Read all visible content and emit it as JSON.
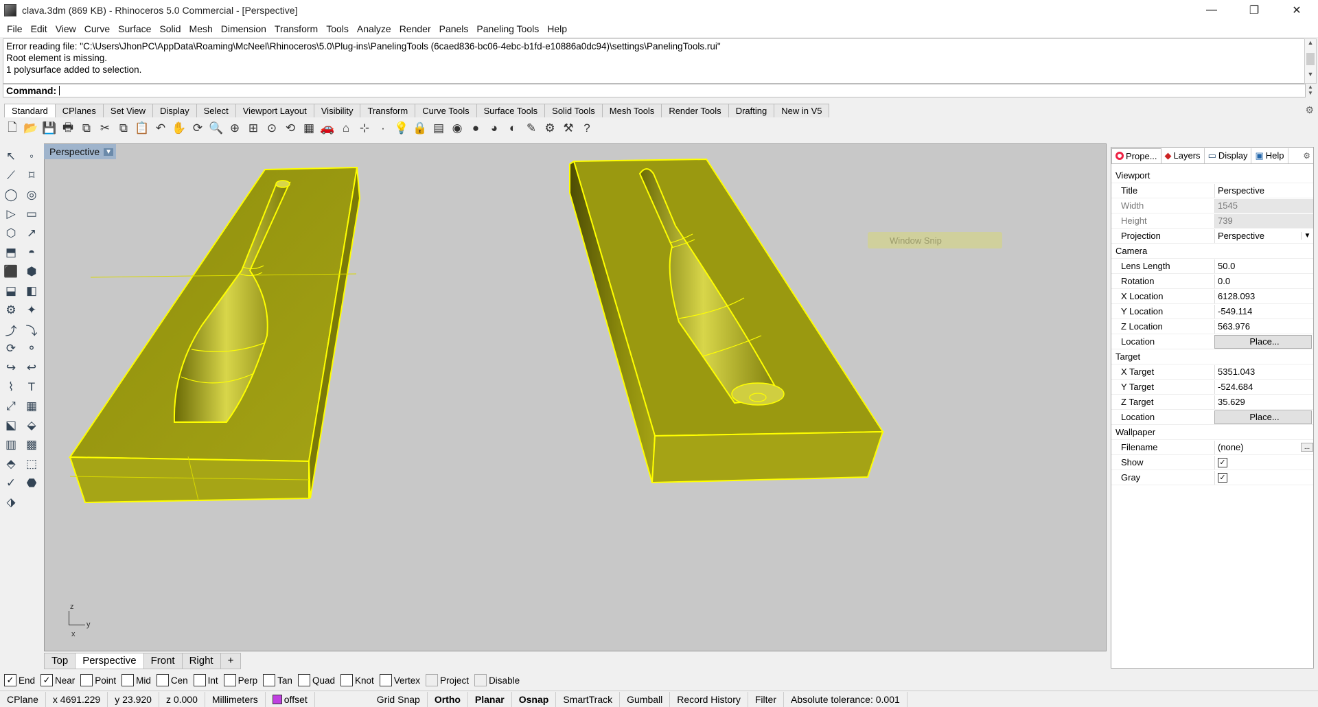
{
  "window": {
    "title": "clava.3dm (869 KB) - Rhinoceros 5.0 Commercial - [Perspective]",
    "minimize": "—",
    "maximize": "❐",
    "close": "✕"
  },
  "menu": [
    "File",
    "Edit",
    "View",
    "Curve",
    "Surface",
    "Solid",
    "Mesh",
    "Dimension",
    "Transform",
    "Tools",
    "Analyze",
    "Render",
    "Panels",
    "Paneling Tools",
    "Help"
  ],
  "history": [
    "Error reading file: \"C:\\Users\\JhonPC\\AppData\\Roaming\\McNeel\\Rhinoceros\\5.0\\Plug-ins\\PanelingTools (6caed836-bc06-4ebc-b1fd-e10886a0dc94)\\settings\\PanelingTools.rui\"",
    "Root element is missing.",
    "1 polysurface added to selection."
  ],
  "command": {
    "label": "Command:",
    "value": ""
  },
  "tabs": [
    "Standard",
    "CPlanes",
    "Set View",
    "Display",
    "Select",
    "Viewport Layout",
    "Visibility",
    "Transform",
    "Curve Tools",
    "Surface Tools",
    "Solid Tools",
    "Mesh Tools",
    "Render Tools",
    "Drafting",
    "New in V5"
  ],
  "toolbar_icons": [
    "new-icon",
    "open-icon",
    "save-icon",
    "print-icon",
    "import-icon",
    "cut-icon",
    "copy-icon",
    "paste-icon",
    "undo-icon",
    "pan-icon",
    "rotate-icon",
    "zoom-icon",
    "zoom-window-icon",
    "zoom-extents-icon",
    "zoom-selected-icon",
    "rotate-view-icon",
    "four-viewports-icon",
    "car-icon",
    "cplane-icon",
    "snap-icon",
    "point-icon",
    "light-icon",
    "lock-icon",
    "layer-icon",
    "color-wheel-icon",
    "render-sphere-icon",
    "material-sphere-icon",
    "render-icon",
    "paint-icon",
    "settings-icon",
    "options-icon",
    "help-icon"
  ],
  "toolbar_glyphs": [
    "🗋",
    "📂",
    "💾",
    "🖶",
    "⧉",
    "✂",
    "⧉",
    "📋",
    "↶",
    "✋",
    "⟳",
    "🔍",
    "⊕",
    "⊞",
    "⊙",
    "⟲",
    "▦",
    "🚗",
    "⌂",
    "⊹",
    "·",
    "💡",
    "🔒",
    "▤",
    "◉",
    "●",
    "◕",
    "◐",
    "✎",
    "⚙",
    "⚒",
    "?"
  ],
  "left_tools": [
    "↖",
    "◦",
    "⟋",
    "⌑",
    "◯",
    "◎",
    "▷",
    "▭",
    "⬡",
    "↗",
    "⬒",
    "◓",
    "⬛",
    "⬢",
    "⬓",
    "◧",
    "⚙",
    "✦",
    "⤴",
    "⤵",
    "⟳",
    "⚬",
    "↪",
    "↩",
    "⌇",
    "T",
    "⤢",
    "▦",
    "⬕",
    "⬙",
    "▥",
    "▩",
    "⬘",
    "⬚",
    "✓",
    "⬣",
    "⬗",
    ""
  ],
  "viewport": {
    "label": "Perspective",
    "snip_text": "Window Snip",
    "axis_z": "z",
    "axis_y": "y",
    "axis_x": "x",
    "object_color": "#9a9a10",
    "edge_color": "#ffff00",
    "background": "#c8c8c8"
  },
  "viewport_tabs": [
    "Top",
    "Perspective",
    "Front",
    "Right",
    "+"
  ],
  "props": {
    "tabs": [
      "Prope...",
      "Layers",
      "Display",
      "Help"
    ],
    "viewport_section": "Viewport",
    "title": {
      "k": "Title",
      "v": "Perspective"
    },
    "width": {
      "k": "Width",
      "v": "1545"
    },
    "height": {
      "k": "Height",
      "v": "739"
    },
    "projection": {
      "k": "Projection",
      "v": "Perspective"
    },
    "camera_section": "Camera",
    "lens": {
      "k": "Lens Length",
      "v": "50.0"
    },
    "rotation": {
      "k": "Rotation",
      "v": "0.0"
    },
    "xloc": {
      "k": "X Location",
      "v": "6128.093"
    },
    "yloc": {
      "k": "Y Location",
      "v": "-549.114"
    },
    "zloc": {
      "k": "Z Location",
      "v": "563.976"
    },
    "cam_location": {
      "k": "Location",
      "v": "Place..."
    },
    "target_section": "Target",
    "xt": {
      "k": "X Target",
      "v": "5351.043"
    },
    "yt": {
      "k": "Y Target",
      "v": "-524.684"
    },
    "zt": {
      "k": "Z Target",
      "v": "35.629"
    },
    "tgt_location": {
      "k": "Location",
      "v": "Place..."
    },
    "wallpaper_section": "Wallpaper",
    "filename": {
      "k": "Filename",
      "v": "(none)"
    },
    "show": {
      "k": "Show"
    },
    "gray": {
      "k": "Gray"
    }
  },
  "osnaps": [
    {
      "label": "End",
      "checked": true
    },
    {
      "label": "Near",
      "checked": true
    },
    {
      "label": "Point",
      "checked": false
    },
    {
      "label": "Mid",
      "checked": false
    },
    {
      "label": "Cen",
      "checked": false
    },
    {
      "label": "Int",
      "checked": false
    },
    {
      "label": "Perp",
      "checked": false
    },
    {
      "label": "Tan",
      "checked": false
    },
    {
      "label": "Quad",
      "checked": false
    },
    {
      "label": "Knot",
      "checked": false
    },
    {
      "label": "Vertex",
      "checked": false
    },
    {
      "label": "Project",
      "checked": false,
      "disabled": true
    },
    {
      "label": "Disable",
      "checked": false,
      "disabled": true
    }
  ],
  "status": {
    "cplane": "CPlane",
    "x": "x 4691.229",
    "y": "y 23.920",
    "z": "z 0.000",
    "units": "Millimeters",
    "layer": "offset",
    "grid_snap": "Grid Snap",
    "ortho": "Ortho",
    "planar": "Planar",
    "osnap": "Osnap",
    "smarttrack": "SmartTrack",
    "gumball": "Gumball",
    "record_history": "Record History",
    "filter": "Filter",
    "tolerance": "Absolute tolerance: 0.001"
  }
}
